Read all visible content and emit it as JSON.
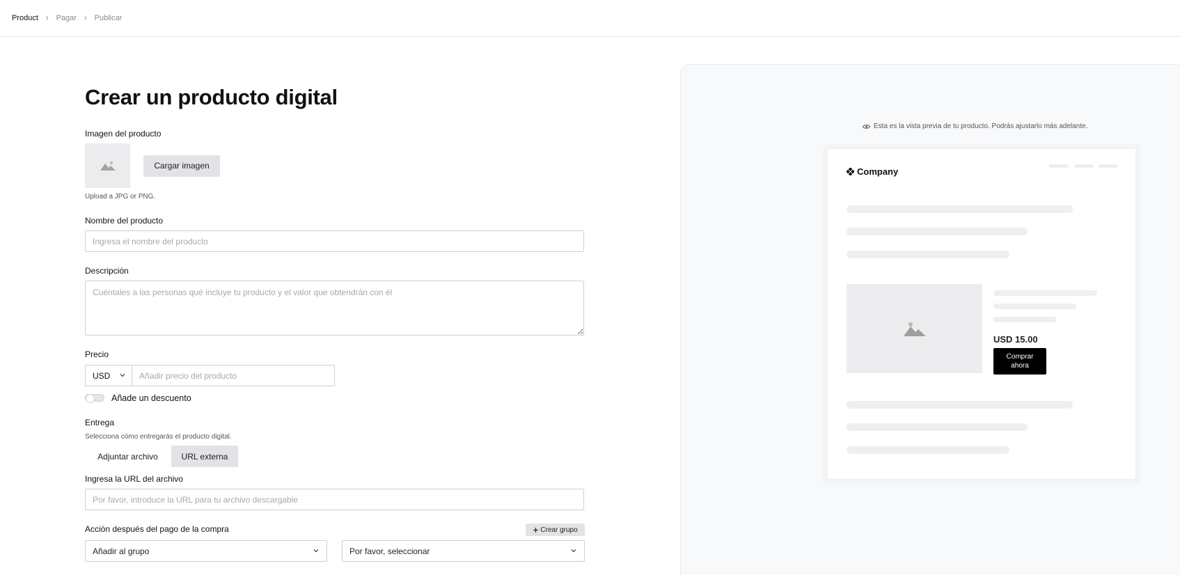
{
  "breadcrumb": {
    "steps": [
      {
        "label": "Product",
        "active": true
      },
      {
        "label": "Pagar",
        "active": false
      },
      {
        "label": "Publicar",
        "active": false
      }
    ]
  },
  "form": {
    "title": "Crear un producto digital",
    "image": {
      "label": "Imagen del producto",
      "upload_button": "Cargar imagen",
      "hint": "Upload a JPG or PNG."
    },
    "name": {
      "label": "Nombre del producto",
      "placeholder": "Ingresa el nombre del producto"
    },
    "description": {
      "label": "Descripción",
      "placeholder": "Cuéntales a las personas qué incluye tu producto y el valor que obtendrán con él"
    },
    "price": {
      "label": "Precio",
      "currency": "USD",
      "placeholder": "Añadir precio del producto"
    },
    "discount": {
      "label": "Añade un descuento",
      "enabled": false
    },
    "delivery": {
      "label": "Entrega",
      "hint": "Selecciona cómo entregarás el producto digital.",
      "options": [
        "Adjuntar archivo",
        "URL externa"
      ],
      "selected": "URL externa"
    },
    "file_url": {
      "label": "Ingresa la URL del archivo",
      "placeholder": "Por favor, introduce la URL para tu archivo descargable"
    },
    "post_payment": {
      "label": "Acción después del pago de la compra",
      "create_group_button": "Crear grupo",
      "action_select": "Añadir al grupo",
      "group_select": "Por favor, seleccionar"
    }
  },
  "preview": {
    "note": "Esta es la vista previa de tu producto. Podrás ajustarlo más adelante.",
    "brand": "Company",
    "price": "USD 15.00",
    "buy_button": "Comprar ahora"
  },
  "colors": {
    "accent": "#000000",
    "panel_bg": "#f8f9fa",
    "skeleton": "#efefef",
    "border": "#cfcfcf"
  },
  "icons": {
    "image_placeholder": "image-icon",
    "chevron": "chevron-down-icon",
    "eye": "eye-icon",
    "brand": "company-logo-icon",
    "plus": "plus-icon"
  }
}
